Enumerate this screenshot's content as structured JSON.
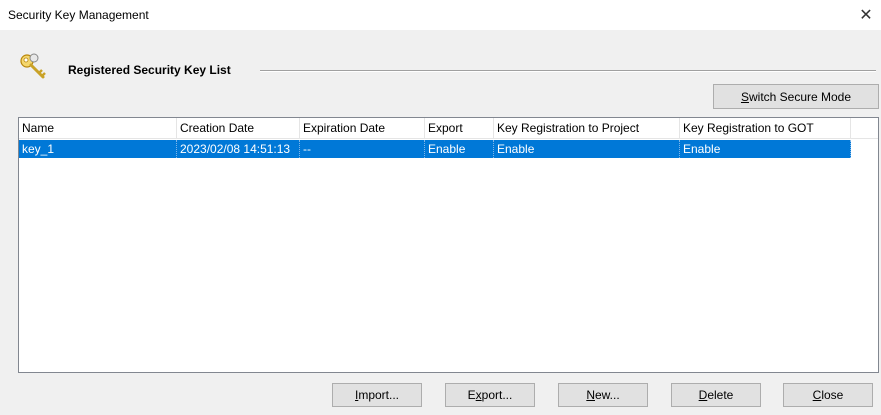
{
  "window": {
    "title": "Security Key Management",
    "close_glyph": "✕"
  },
  "section": {
    "icon": "key-icon",
    "title": "Registered Security Key List"
  },
  "buttons": {
    "switch_secure_mode": {
      "mnemonic": "S",
      "rest": "witch Secure Mode"
    },
    "import": {
      "mnemonic": "I",
      "rest": "mport..."
    },
    "export": {
      "pre": "E",
      "mnemonic": "x",
      "rest": "port..."
    },
    "new": {
      "mnemonic": "N",
      "rest": "ew..."
    },
    "delete": {
      "mnemonic": "D",
      "rest": "elete"
    },
    "close": {
      "mnemonic": "C",
      "rest": "lose"
    }
  },
  "table": {
    "columns": [
      "Name",
      "Creation Date",
      "Expiration Date",
      "Export",
      "Key Registration to Project",
      "Key Registration to GOT"
    ],
    "rows": [
      {
        "name": "key_1",
        "creation_date": "2023/02/08 14:51:13",
        "expiration_date": "--",
        "export": "Enable",
        "key_reg_project": "Enable",
        "key_reg_got": "Enable",
        "selected": true
      }
    ]
  },
  "colors": {
    "selection": "#0078d7",
    "window_bg": "#f0f0f0",
    "key_gold": "#e8b828"
  }
}
